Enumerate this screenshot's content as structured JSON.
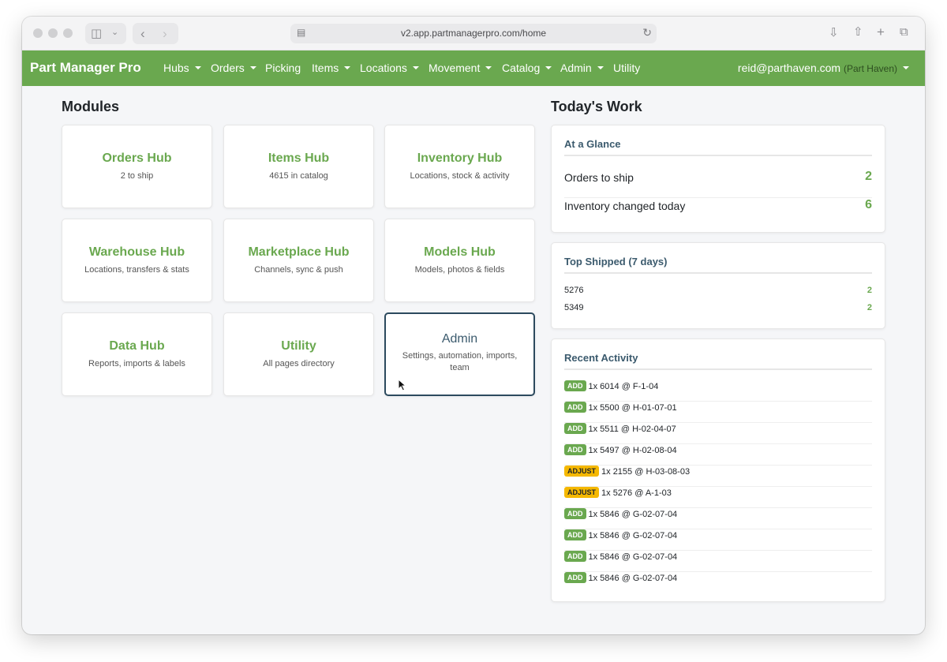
{
  "browser": {
    "url": "v2.app.partmanagerpro.com/home"
  },
  "nav": {
    "brand": "Part Manager Pro",
    "items": [
      {
        "label": "Hubs",
        "dropdown": true
      },
      {
        "label": "Orders",
        "dropdown": true
      },
      {
        "label": "Picking",
        "dropdown": false
      },
      {
        "label": "Items",
        "dropdown": true
      },
      {
        "label": "Locations",
        "dropdown": true
      },
      {
        "label": "Movement",
        "dropdown": true
      },
      {
        "label": "Catalog",
        "dropdown": true
      },
      {
        "label": "Admin",
        "dropdown": true
      },
      {
        "label": "Utility",
        "dropdown": false
      }
    ],
    "user_email": "reid@parthaven.com",
    "user_tenant": "(Part Haven)"
  },
  "modules": {
    "title": "Modules",
    "items": [
      {
        "title": "Orders Hub",
        "subtitle": "2 to ship"
      },
      {
        "title": "Items Hub",
        "subtitle": "4615 in catalog"
      },
      {
        "title": "Inventory Hub",
        "subtitle": "Locations, stock & activity"
      },
      {
        "title": "Warehouse Hub",
        "subtitle": "Locations, transfers & stats"
      },
      {
        "title": "Marketplace Hub",
        "subtitle": "Channels, sync & push"
      },
      {
        "title": "Models Hub",
        "subtitle": "Models, photos & fields"
      },
      {
        "title": "Data Hub",
        "subtitle": "Reports, imports & labels"
      },
      {
        "title": "Utility",
        "subtitle": "All pages directory"
      },
      {
        "title": "Admin",
        "subtitle": "Settings, automation, imports, team"
      }
    ]
  },
  "today": {
    "title": "Today's Work",
    "glance": {
      "title": "At a Glance",
      "rows": [
        {
          "label": "Orders to ship",
          "value": "2"
        },
        {
          "label": "Inventory changed today",
          "value": "6"
        }
      ]
    },
    "top_shipped": {
      "title": "Top Shipped (7 days)",
      "rows": [
        {
          "item": "5276",
          "count": "2"
        },
        {
          "item": "5349",
          "count": "2"
        }
      ]
    },
    "recent": {
      "title": "Recent Activity",
      "rows": [
        {
          "type": "ADD",
          "text": "1x 6014 @ F-1-04"
        },
        {
          "type": "ADD",
          "text": "1x 5500 @ H-01-07-01"
        },
        {
          "type": "ADD",
          "text": "1x 5511 @ H-02-04-07"
        },
        {
          "type": "ADD",
          "text": "1x 5497 @ H-02-08-04"
        },
        {
          "type": "ADJUST",
          "text": "1x 2155 @ H-03-08-03"
        },
        {
          "type": "ADJUST",
          "text": "1x 5276 @ A-1-03"
        },
        {
          "type": "ADD",
          "text": "1x 5846 @ G-02-07-04"
        },
        {
          "type": "ADD",
          "text": "1x 5846 @ G-02-07-04"
        },
        {
          "type": "ADD",
          "text": "1x 5846 @ G-02-07-04"
        },
        {
          "type": "ADD",
          "text": "1x 5846 @ G-02-07-04"
        }
      ]
    }
  },
  "colors": {
    "brand_green": "#6aa84f",
    "heading_blue": "#3b5a6d",
    "adjust_yellow": "#f5b800"
  }
}
